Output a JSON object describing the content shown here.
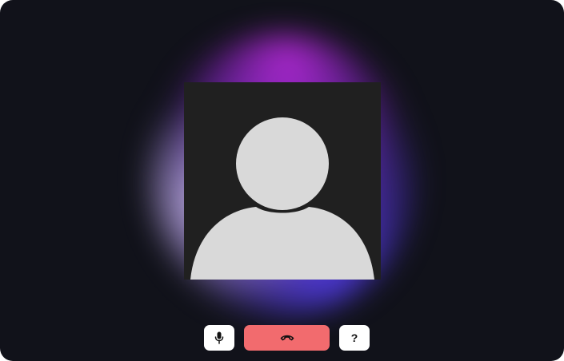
{
  "call": {
    "participant_avatar": "person-placeholder-icon"
  },
  "controls": {
    "mic_icon": "microphone-icon",
    "hangup_icon": "phone-hangup-icon",
    "help_label": "?"
  },
  "colors": {
    "background": "#11121a",
    "tile_background": "#202020",
    "avatar": "#d9d9d9",
    "hangup_button": "#f26b6e",
    "button_light": "#ffffff"
  }
}
